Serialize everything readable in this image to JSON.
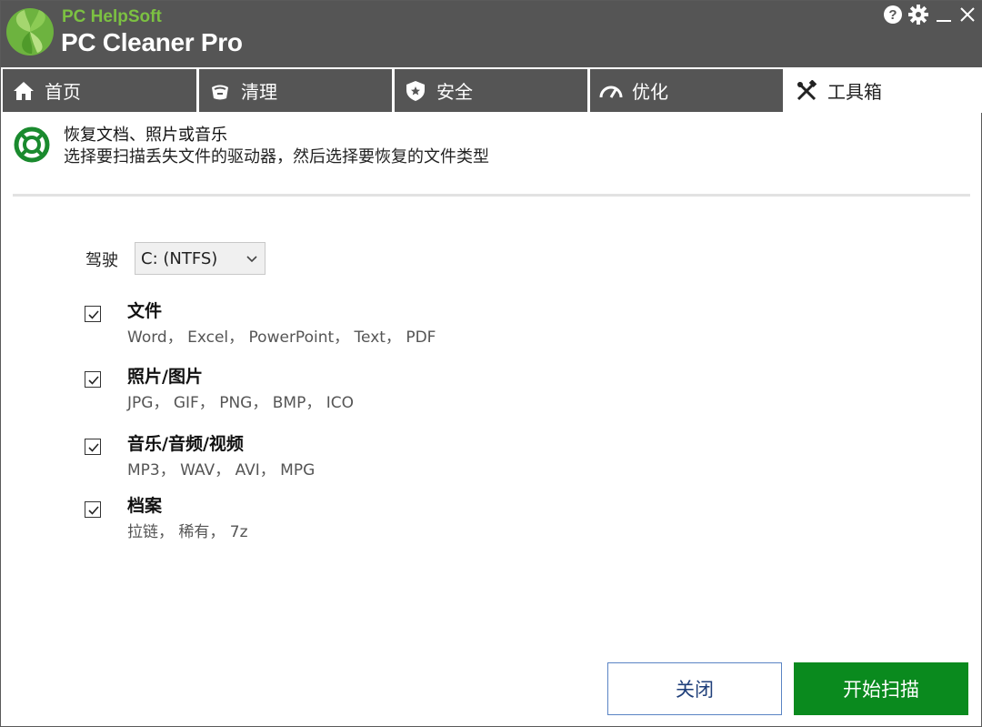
{
  "app": {
    "brand_sub": "PC HelpSoft",
    "brand_main": "PC Cleaner Pro"
  },
  "window_controls": {
    "help_icon": "help-icon",
    "settings_icon": "gear-icon",
    "minimize_icon": "minimize-icon",
    "close_icon": "close-icon"
  },
  "tabs": [
    {
      "label": "首页",
      "icon": "home-icon",
      "active": false
    },
    {
      "label": "清理",
      "icon": "broom-icon",
      "active": false
    },
    {
      "label": "安全",
      "icon": "shield-icon",
      "active": false
    },
    {
      "label": "优化",
      "icon": "speedometer-icon",
      "active": false
    },
    {
      "label": "工具箱",
      "icon": "tools-icon",
      "active": true
    }
  ],
  "header": {
    "title": "恢复文档、照片或音乐",
    "subtitle": "选择要扫描丢失文件的驱动器，然后选择要恢复的文件类型"
  },
  "drive": {
    "label": "驾驶",
    "selected": "C: (NTFS)"
  },
  "options": [
    {
      "title": "文件",
      "types": "Word， Excel， PowerPoint， Text， PDF",
      "checked": true
    },
    {
      "title": "照片/图片",
      "types": "JPG， GIF， PNG， BMP， ICO",
      "checked": true
    },
    {
      "title": "音乐/音频/视频",
      "types": "MP3， WAV， AVI， MPG",
      "checked": true
    },
    {
      "title": "档案",
      "types": "拉链， 稀有， 7z",
      "checked": true
    }
  ],
  "buttons": {
    "close_label": "关闭",
    "start_label": "开始扫描"
  },
  "colors": {
    "titlebar": "#555555",
    "brand_green": "#7cc142",
    "start_button": "#0a8a1e",
    "close_button_border": "#5b84c4"
  }
}
